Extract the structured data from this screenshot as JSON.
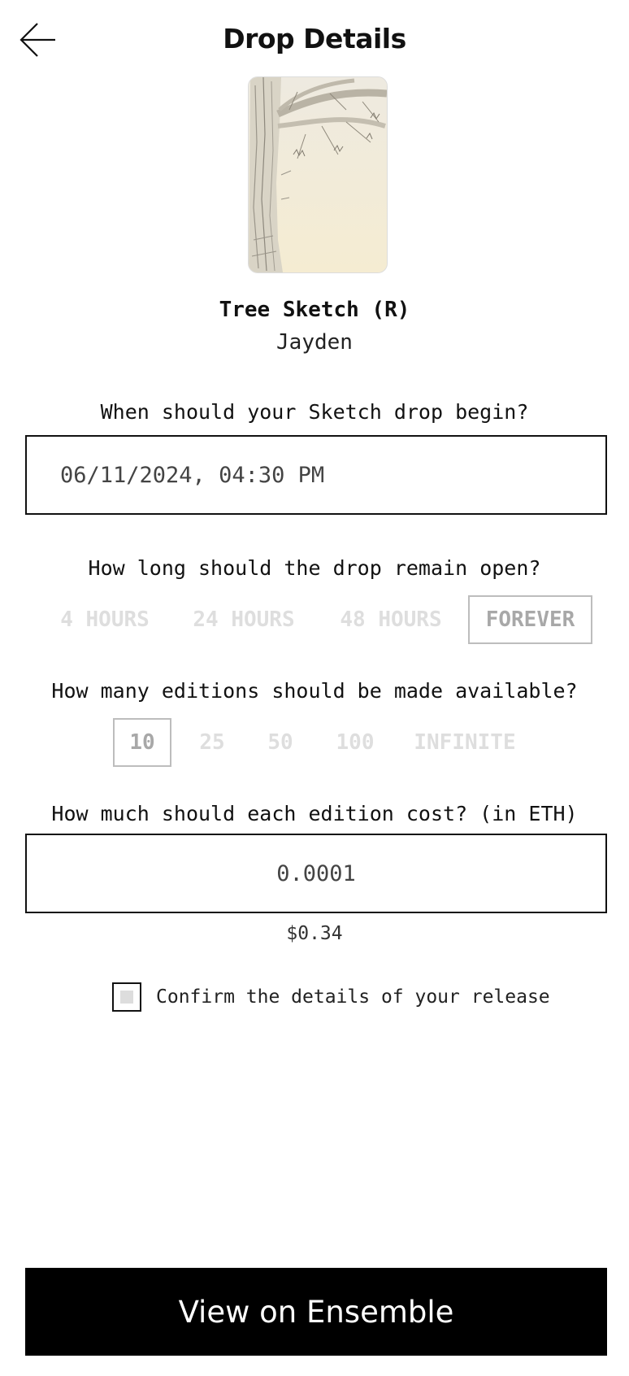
{
  "header": {
    "title": "Drop Details",
    "back_icon": "arrow-left-icon"
  },
  "artwork": {
    "title": "Tree Sketch (R)",
    "artist": "Jayden"
  },
  "start": {
    "question": "When should your Sketch drop begin?",
    "value": "06/11/2024, 04:30 PM"
  },
  "duration": {
    "question": "How long should the drop remain open?",
    "options": [
      "4 HOURS",
      "24 HOURS",
      "48 HOURS",
      "FOREVER"
    ],
    "selected": "FOREVER"
  },
  "editions": {
    "question": "How many editions should be made available?",
    "options": [
      "10",
      "25",
      "50",
      "100",
      "INFINITE"
    ],
    "selected": "10"
  },
  "price": {
    "question": "How much should each edition cost? (in ETH)",
    "value": "0.0001",
    "usd": "$0.34"
  },
  "confirm": {
    "label": "Confirm the details of your release",
    "checked": false
  },
  "cta": {
    "label": "View on Ensemble"
  },
  "colors": {
    "primary": "#000000",
    "background": "#ffffff",
    "inactive_option": "#dedede",
    "selected_option_border": "#bdbdbd"
  }
}
